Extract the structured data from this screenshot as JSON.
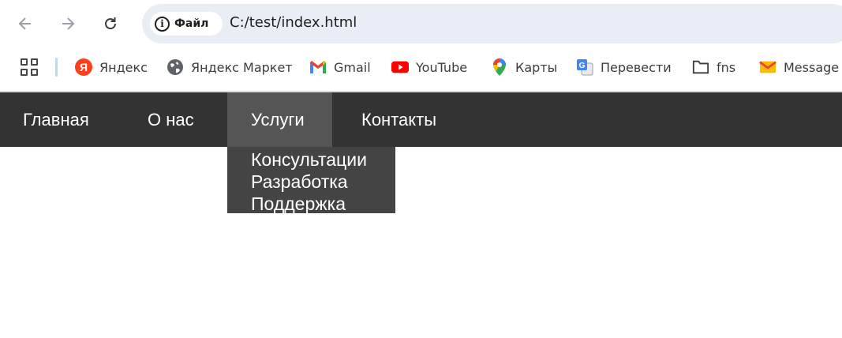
{
  "browser": {
    "chip_label": "Файл",
    "url": "C:/test/index.html"
  },
  "bookmarks": [
    {
      "label": "Яндекс",
      "icon": "yandex-icon"
    },
    {
      "label": "Яндекс Маркет",
      "icon": "globe-icon"
    },
    {
      "label": "Gmail",
      "icon": "gmail-icon"
    },
    {
      "label": "YouTube",
      "icon": "youtube-icon"
    },
    {
      "label": "Карты",
      "icon": "maps-pin-icon"
    },
    {
      "label": "Перевести",
      "icon": "translate-icon"
    },
    {
      "label": "fns",
      "icon": "folder-icon"
    },
    {
      "label": "Message",
      "icon": "mail-envelope-icon"
    }
  ],
  "nav": {
    "items": [
      {
        "label": "Главная"
      },
      {
        "label": "О нас"
      },
      {
        "label": "Услуги"
      },
      {
        "label": "Контакты"
      }
    ],
    "dropdown": [
      {
        "label": "Консультации"
      },
      {
        "label": "Разработка"
      },
      {
        "label": "Поддержка"
      }
    ]
  },
  "colors": {
    "nav_bg": "#333333",
    "nav_active_bg": "#555555",
    "dropdown_bg": "#444444",
    "omnibox_bg": "#e9eef6"
  }
}
